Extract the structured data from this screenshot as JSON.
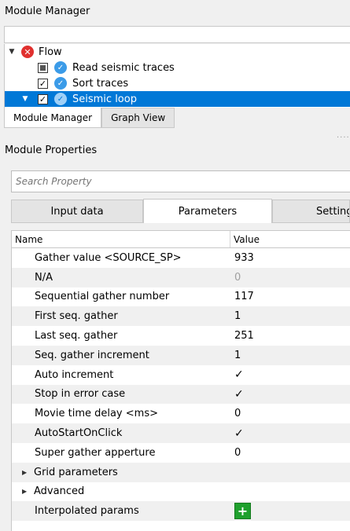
{
  "module_manager": {
    "title": "Module Manager",
    "tree": {
      "root": {
        "label": "Flow",
        "icon": "error-icon"
      },
      "items": [
        {
          "label": "Read seismic traces",
          "checked": "partial",
          "icon": "ok-icon"
        },
        {
          "label": "Sort traces",
          "checked": "✓",
          "icon": "ok-icon"
        },
        {
          "label": "Seismic loop",
          "checked": "✓",
          "icon": "ok-icon",
          "selected": true
        }
      ]
    },
    "tabs": [
      "Module Manager",
      "Graph View"
    ],
    "active_tab": "Module Manager"
  },
  "module_properties": {
    "title": "Module Properties",
    "search_placeholder": "Search Property",
    "tabs": [
      "Input data",
      "Parameters",
      "Settings"
    ],
    "active_tab": "Parameters",
    "columns": {
      "name": "Name",
      "value": "Value"
    },
    "rows": [
      {
        "name": "Gather value <SOURCE_SP>",
        "value": "933"
      },
      {
        "name": "N/A",
        "value": "0"
      },
      {
        "name": "Sequential gather number",
        "value": "117"
      },
      {
        "name": "First seq. gather",
        "value": "1"
      },
      {
        "name": "Last seq. gather",
        "value": "251"
      },
      {
        "name": "Seq. gather increment",
        "value": "1"
      },
      {
        "name": "Auto increment",
        "value": "✓"
      },
      {
        "name": "Stop in error case",
        "value": "✓"
      },
      {
        "name": "Movie time delay <ms>",
        "value": "0"
      },
      {
        "name": "AutoStartOnClick",
        "value": "✓"
      },
      {
        "name": "Super gather apperture",
        "value": "0"
      },
      {
        "name": "Grid parameters",
        "value": ""
      },
      {
        "name": "Advanced",
        "value": ""
      },
      {
        "name": "Interpolated params",
        "value": "+"
      }
    ]
  },
  "colors": {
    "selection": "#0078d7",
    "add_button": "#1fa02d",
    "error": "#e0302e"
  }
}
